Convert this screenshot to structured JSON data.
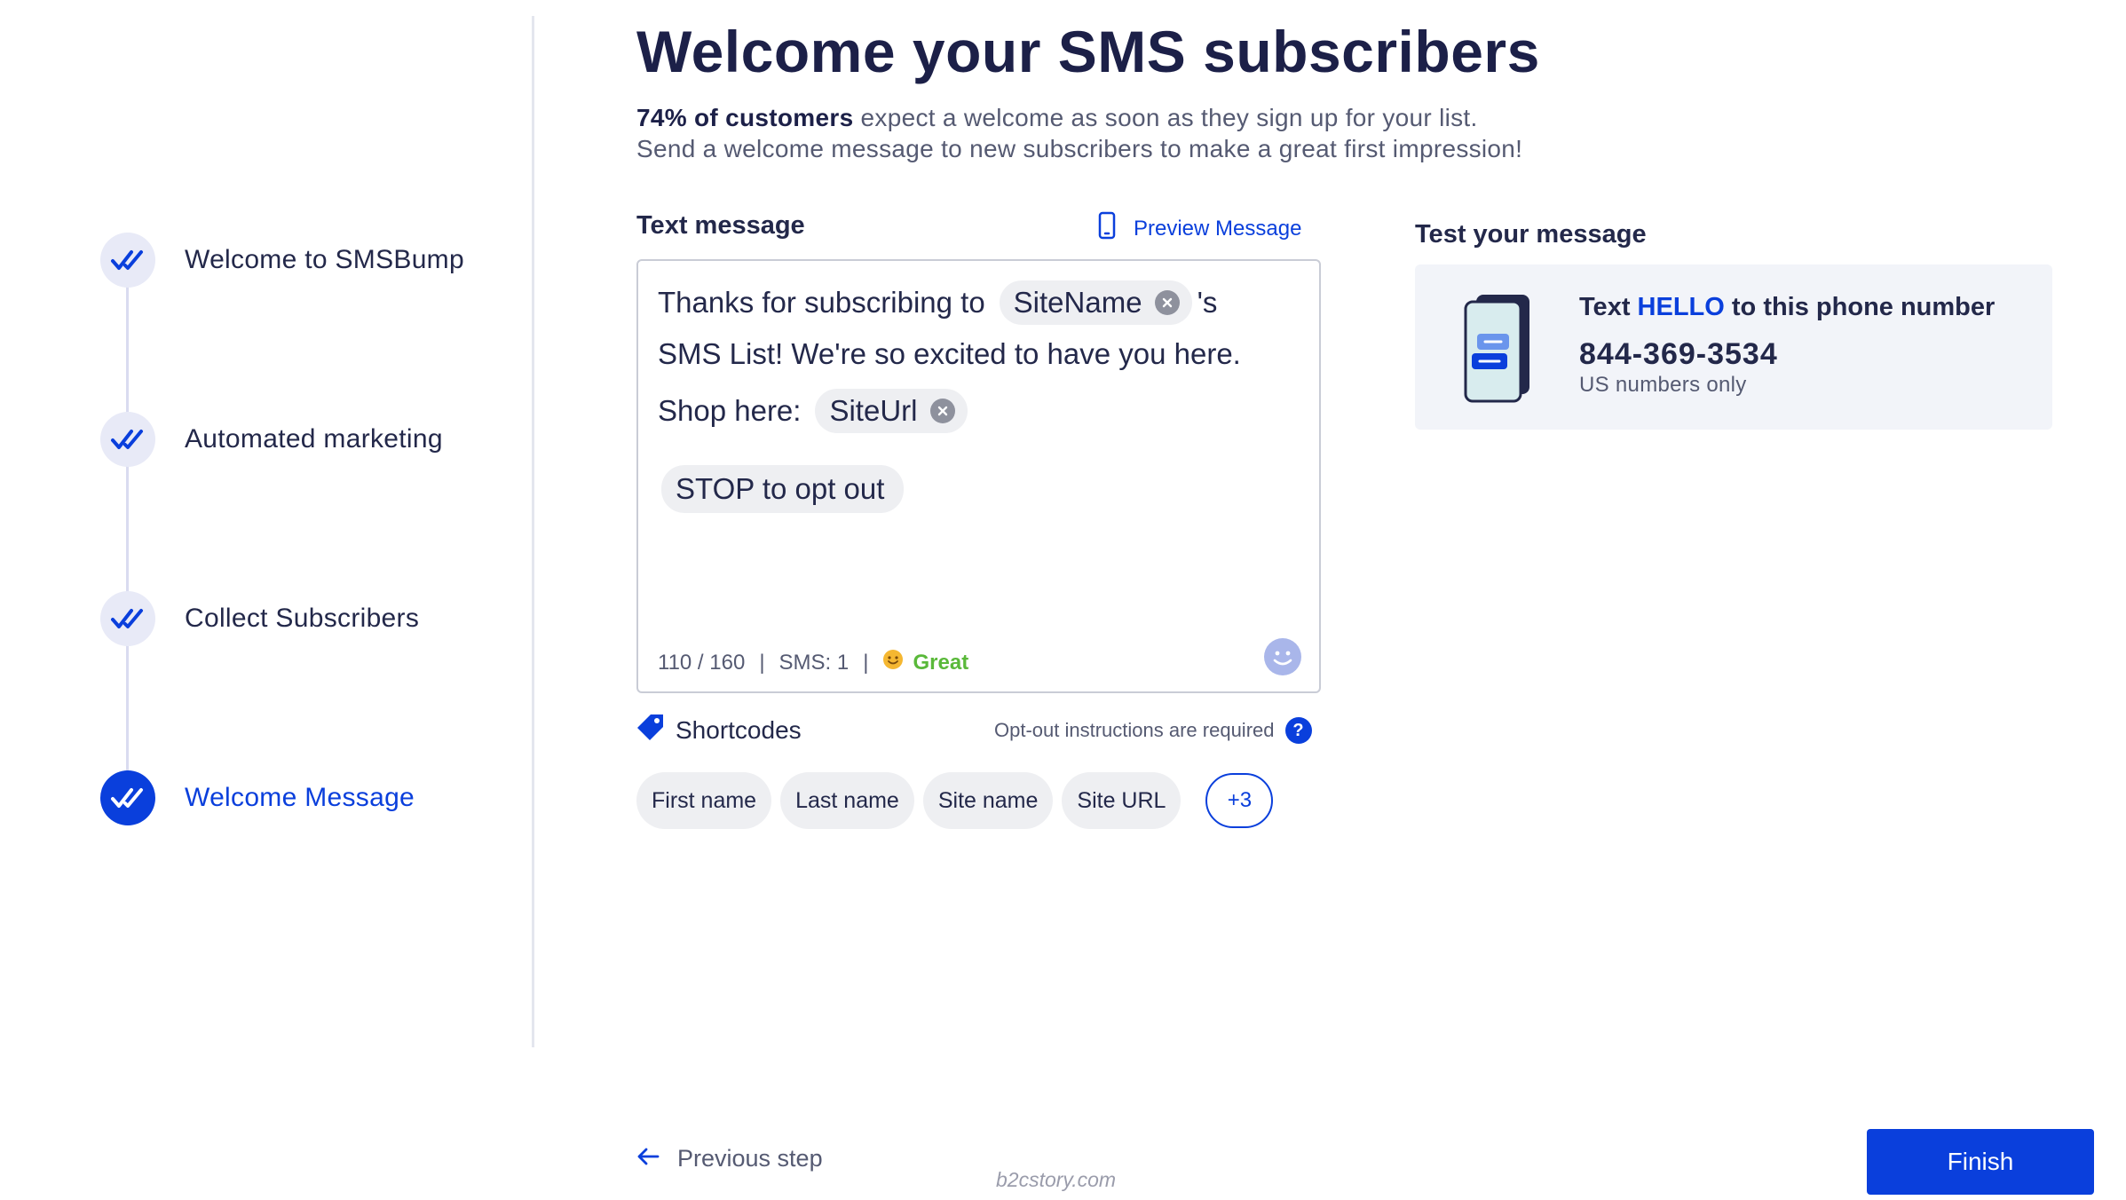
{
  "sidebar": {
    "steps": [
      {
        "label": "Welcome to SMSBump",
        "state": "completed"
      },
      {
        "label": "Automated marketing",
        "state": "completed"
      },
      {
        "label": "Collect Subscribers",
        "state": "completed"
      },
      {
        "label": "Welcome Message",
        "state": "active"
      }
    ]
  },
  "header": {
    "title": "Welcome your SMS subscribers",
    "stat_bold": "74% of customers",
    "stat_rest": " expect a welcome as soon as they sign up for your list.",
    "line2": "Send a welcome message to new subscribers to make a great first impression!"
  },
  "message": {
    "section_label": "Text message",
    "preview_label": "Preview Message",
    "line1_text": "Thanks for subscribing to",
    "line1_chip": "SiteName",
    "line1_suffix": "'s",
    "line2_text": "SMS List! We're so excited to have you here.",
    "line3_text": "Shop here:",
    "line3_chip": "SiteUrl",
    "stop_chip": "STOP to opt out",
    "char_count": "110 / 160",
    "sms_count": "SMS: 1",
    "quality": "Great"
  },
  "shortcodes": {
    "label": "Shortcodes",
    "note": "Opt-out instructions are required",
    "help_label": "?",
    "items": [
      "First name",
      "Last name",
      "Site name",
      "Site URL"
    ],
    "more": "+3"
  },
  "test": {
    "section_label": "Test your message",
    "line_prefix": "Text ",
    "keyword": "HELLO",
    "line_suffix": " to this phone number",
    "number": "844-369-3534",
    "note": "US numbers only"
  },
  "footer": {
    "previous_label": "Previous step",
    "finish_label": "Finish",
    "watermark": "b2cstory.com"
  },
  "colors": {
    "accent": "#0a3fdc",
    "text_dark": "#23284a",
    "text_muted": "#555a72",
    "great": "#5ab93a",
    "chip_bg": "#eeeff2",
    "card_bg": "#f2f4f9"
  }
}
